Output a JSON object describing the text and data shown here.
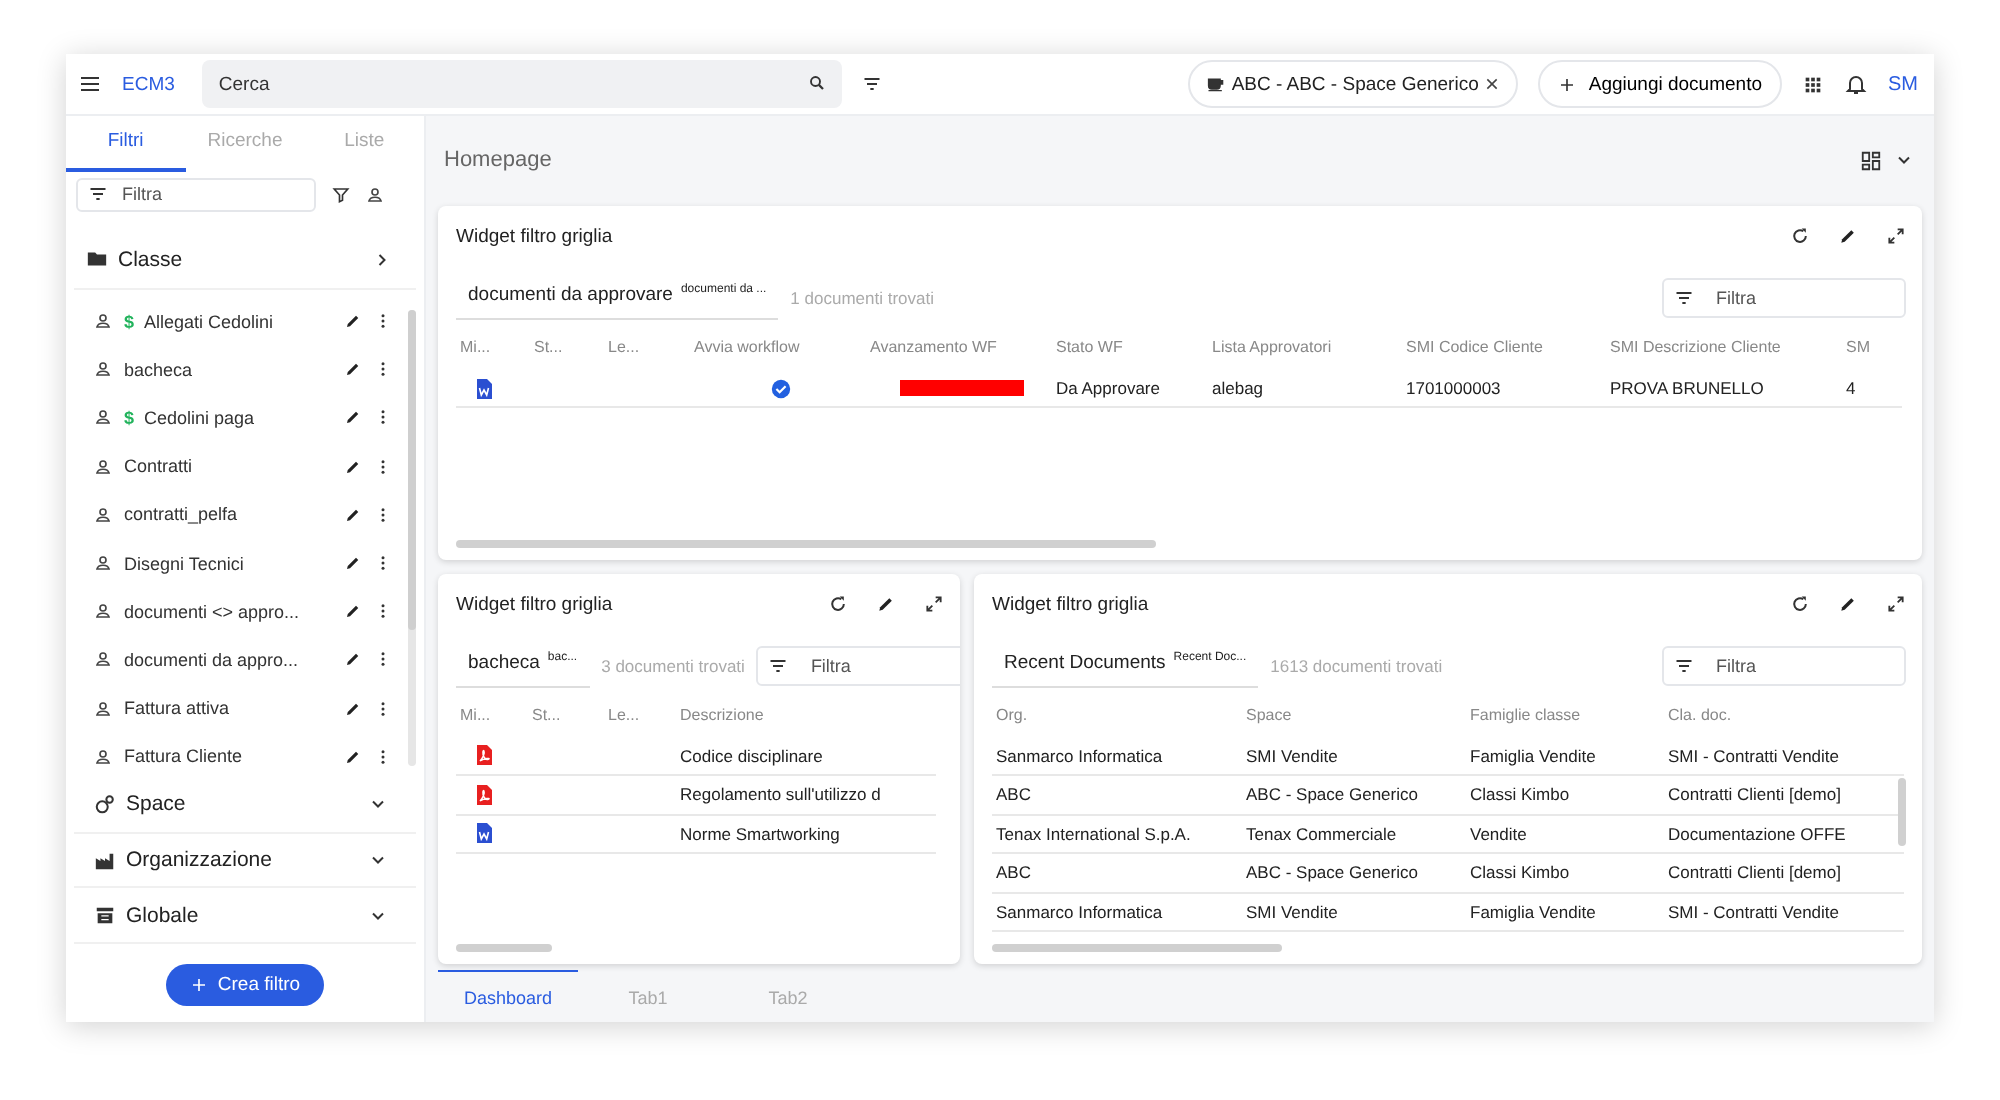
{
  "topbar": {
    "brand": "ECM3",
    "search_placeholder": "Cerca",
    "space_chip": "ABC - ABC - Space Generico",
    "add_button": "Aggiungi documento",
    "user": "SM"
  },
  "sidebar": {
    "tabs": [
      {
        "label": "Filtri",
        "selected": true
      },
      {
        "label": "Ricerche",
        "selected": false
      },
      {
        "label": "Liste",
        "selected": false
      }
    ],
    "filter_placeholder": "Filtra",
    "class_section": {
      "title": "Classe",
      "items": [
        {
          "label": "Allegati Cedolini",
          "prefix": "$"
        },
        {
          "label": "bacheca"
        },
        {
          "label": "Cedolini paga",
          "prefix": "$"
        },
        {
          "label": "Contratti"
        },
        {
          "label": "contratti_pelfa"
        },
        {
          "label": "Disegni Tecnici"
        },
        {
          "label": "documenti <> appro..."
        },
        {
          "label": "documenti da appro..."
        },
        {
          "label": "Fattura attiva"
        },
        {
          "label": "Fattura Cliente"
        }
      ]
    },
    "sections": [
      {
        "title": "Space",
        "kind": "space"
      },
      {
        "title": "Organizzazione",
        "kind": "org"
      },
      {
        "title": "Globale",
        "kind": "global"
      }
    ],
    "create_button": "Crea filtro"
  },
  "main": {
    "title": "Homepage",
    "widgets": [
      {
        "title": "Widget filtro griglia",
        "view_name": "documenti da approvare",
        "view_badge": "documenti da ...",
        "count": "1 documenti trovati",
        "filter_placeholder": "Filtra",
        "columns": [
          "Mi...",
          "St...",
          "Le...",
          "Avvia workflow",
          "Avanzamento WF",
          "Stato WF",
          "Lista Approvatori",
          "SMI Codice Cliente",
          "SMI Descrizione Cliente",
          "SM"
        ],
        "rows": [
          [
            {
              "kind": "word"
            },
            {
              "kind": "empty"
            },
            {
              "kind": "empty"
            },
            {
              "kind": "check"
            },
            {
              "kind": "progress",
              "level": 1
            },
            {
              "kind": "text",
              "text": "Da Approvare"
            },
            {
              "kind": "text",
              "text": "alebag"
            },
            {
              "kind": "text",
              "text": "1701000003"
            },
            {
              "kind": "text",
              "text": "PROVA BRUNELLO"
            },
            {
              "kind": "text",
              "text": "4"
            }
          ]
        ]
      },
      {
        "title": "Widget filtro griglia",
        "view_name": "bacheca",
        "view_badge": "bac...",
        "count": "3 documenti trovati",
        "filter_placeholder": "Filtra",
        "columns": [
          "Mi...",
          "St...",
          "Le...",
          "Descrizione"
        ],
        "rows": [
          [
            {
              "kind": "pdf"
            },
            {
              "kind": "empty"
            },
            {
              "kind": "empty"
            },
            {
              "kind": "text",
              "text": "Codice disciplinare"
            }
          ],
          [
            {
              "kind": "pdf"
            },
            {
              "kind": "empty"
            },
            {
              "kind": "empty"
            },
            {
              "kind": "text",
              "text": "Regolamento sull'utilizzo d"
            }
          ],
          [
            {
              "kind": "word"
            },
            {
              "kind": "empty"
            },
            {
              "kind": "empty"
            },
            {
              "kind": "text",
              "text": "Norme Smartworking"
            }
          ]
        ]
      },
      {
        "title": "Widget filtro griglia",
        "view_name": "Recent Documents",
        "view_badge": "Recent Doc...",
        "count": "1613 documenti trovati",
        "filter_placeholder": "Filtra",
        "columns": [
          "Org.",
          "Space",
          "Famiglie classe",
          "Cla. doc."
        ],
        "rows": [
          [
            {
              "kind": "text",
              "text": "Sanmarco Informatica"
            },
            {
              "kind": "text",
              "text": "SMI Vendite"
            },
            {
              "kind": "text",
              "text": "Famiglia Vendite"
            },
            {
              "kind": "text",
              "text": "SMI - Contratti Vendite"
            }
          ],
          [
            {
              "kind": "text",
              "text": "ABC"
            },
            {
              "kind": "text",
              "text": "ABC - Space Generico"
            },
            {
              "kind": "text",
              "text": "Classi Kimbo"
            },
            {
              "kind": "text",
              "text": "Contratti Clienti [demo]"
            }
          ],
          [
            {
              "kind": "text",
              "text": "Tenax International S.p.A."
            },
            {
              "kind": "text",
              "text": "Tenax Commerciale"
            },
            {
              "kind": "text",
              "text": "Vendite"
            },
            {
              "kind": "text",
              "text": "Documentazione OFFE"
            }
          ],
          [
            {
              "kind": "text",
              "text": "ABC"
            },
            {
              "kind": "text",
              "text": "ABC - Space Generico"
            },
            {
              "kind": "text",
              "text": "Classi Kimbo"
            },
            {
              "kind": "text",
              "text": "Contratti Clienti [demo]"
            }
          ],
          [
            {
              "kind": "text",
              "text": "Sanmarco Informatica"
            },
            {
              "kind": "text",
              "text": "SMI Vendite"
            },
            {
              "kind": "text",
              "text": "Famiglia Vendite"
            },
            {
              "kind": "text",
              "text": "SMI - Contratti Vendite"
            }
          ]
        ]
      }
    ],
    "bottom_tabs": [
      {
        "label": "Dashboard",
        "selected": true
      },
      {
        "label": "Tab1",
        "selected": false
      },
      {
        "label": "Tab2",
        "selected": false
      }
    ]
  }
}
